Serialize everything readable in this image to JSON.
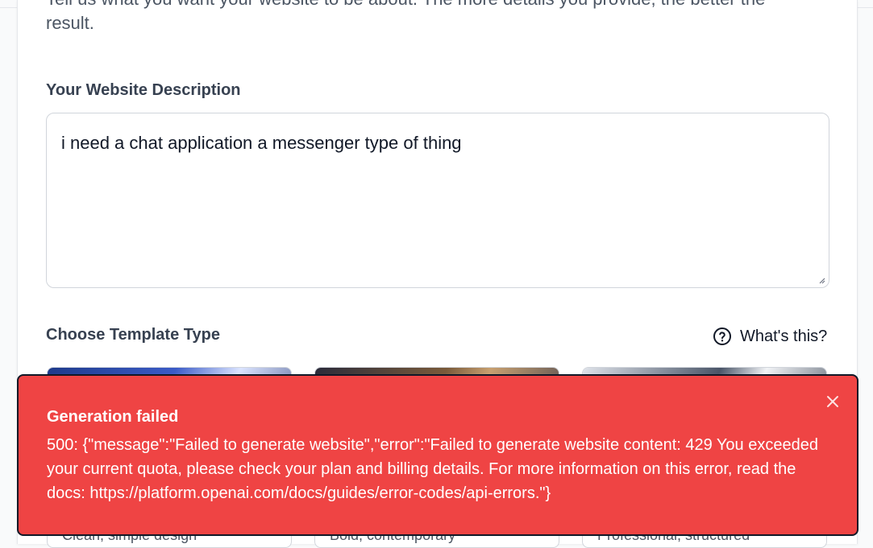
{
  "intro": {
    "text": "Tell us what you want your website to be about. The more details you provide, the better the result."
  },
  "description": {
    "label": "Your Website Description",
    "value": "i need a chat application a messenger type of thing"
  },
  "template": {
    "label": "Choose Template Type",
    "help_label": "What's this?",
    "options": [
      {
        "caption": "Clean, simple design"
      },
      {
        "caption": "Bold, contemporary"
      },
      {
        "caption": "Professional, structured"
      }
    ]
  },
  "toast": {
    "title": "Generation failed",
    "message": "500: {\"message\":\"Failed to generate website\",\"error\":\"Failed to generate website content: 429 You exceeded your current quota, please check your plan and billing details. For more information on this error, read the docs: https://platform.openai.com/docs/guides/error-codes/api-errors.\"}",
    "color": "#ef4444"
  }
}
